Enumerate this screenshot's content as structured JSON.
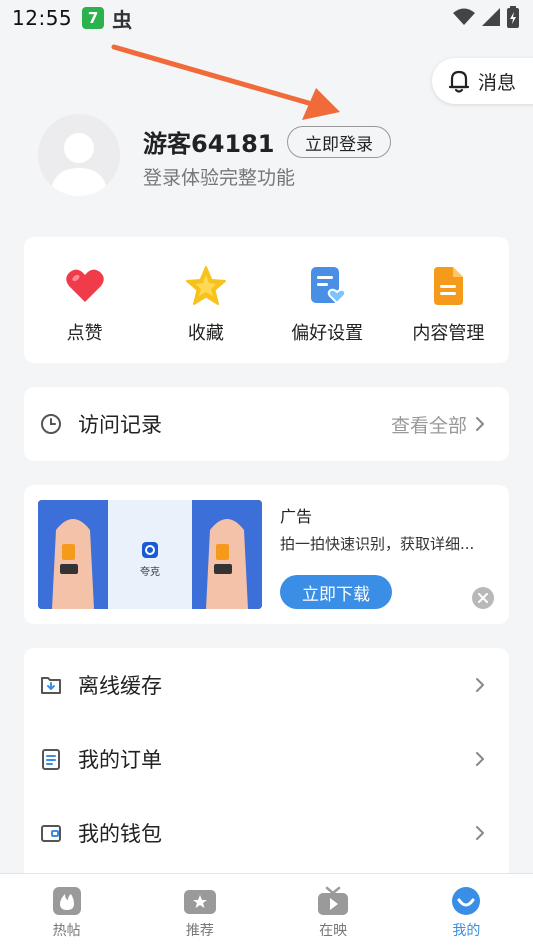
{
  "status_bar": {
    "time": "12:55",
    "app_badge": "7",
    "glyph": "虫"
  },
  "header": {
    "message_label": "消息"
  },
  "profile": {
    "username": "游客64181",
    "login_button": "立即登录",
    "subtitle": "登录体验完整功能"
  },
  "quick_actions": [
    {
      "label": "点赞",
      "icon": "heart-icon",
      "color": "#f03b4a"
    },
    {
      "label": "收藏",
      "icon": "star-icon",
      "color": "#f8c21c"
    },
    {
      "label": "偏好设置",
      "icon": "preference-icon",
      "color": "#4a8fe6"
    },
    {
      "label": "内容管理",
      "icon": "document-icon",
      "color": "#f59a1a"
    }
  ],
  "history": {
    "title": "访问记录",
    "view_all": "查看全部"
  },
  "ad": {
    "tag": "广告",
    "description": "拍一拍快速识别，获取详细...",
    "download_button": "立即下载",
    "image_brand": "夸克"
  },
  "menu": [
    {
      "label": "离线缓存",
      "icon": "download-folder-icon"
    },
    {
      "label": "我的订单",
      "icon": "order-icon"
    },
    {
      "label": "我的钱包",
      "icon": "wallet-icon"
    }
  ],
  "tabs": [
    {
      "label": "热帖",
      "icon": "flame-icon",
      "active": false
    },
    {
      "label": "推荐",
      "icon": "recommend-icon",
      "active": false
    },
    {
      "label": "在映",
      "icon": "tv-icon",
      "active": false
    },
    {
      "label": "我的",
      "icon": "profile-smile-icon",
      "active": true
    }
  ],
  "colors": {
    "accent": "#3a8ee6",
    "annotation_arrow": "#f06a3a"
  }
}
